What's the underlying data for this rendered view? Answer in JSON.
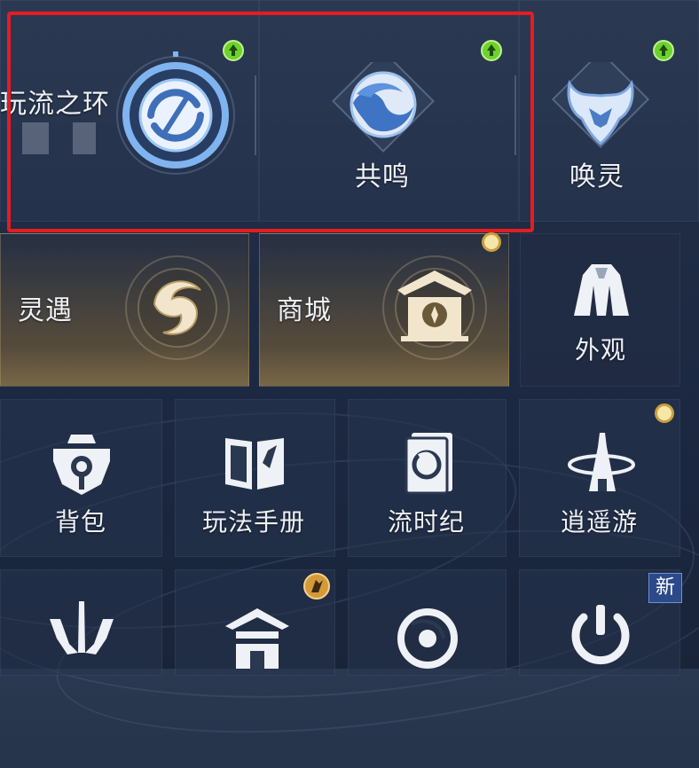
{
  "top_row": {
    "ring_label": "玩流之环",
    "resonance_label": "共鸣",
    "summon_label": "唤灵"
  },
  "second_row": {
    "encounter_label": "灵遇",
    "shop_label": "商城",
    "appearance_label": "外观"
  },
  "third_row": {
    "bag_label": "背包",
    "handbook_label": "玩法手册",
    "chronicle_label": "流时纪",
    "wander_label": "逍遥游"
  },
  "fourth_row": {
    "new_badge": "新"
  },
  "colors": {
    "highlight_box": "#e51c23",
    "upgrade_dot": "#6dd22e",
    "notice_dot": "#f6e7a8",
    "accent_blue": "#6fa8e8"
  },
  "icons": [
    "ring-icon",
    "resonance-icon",
    "summon-icon",
    "encounter-icon",
    "shop-icon",
    "cloak-icon",
    "backpack-icon",
    "book-icon",
    "card-icon",
    "wander-icon",
    "trident-icon",
    "house-icon",
    "vortex-icon",
    "power-icon"
  ]
}
